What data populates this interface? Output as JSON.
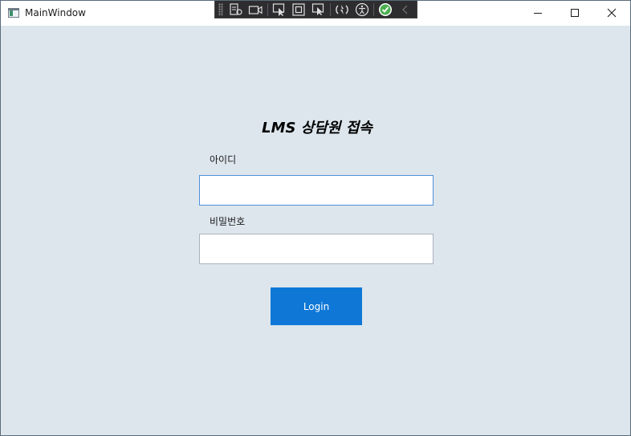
{
  "window": {
    "title": "MainWindow",
    "controls": {
      "minimize_icon": "minimize-icon",
      "maximize_icon": "maximize-icon",
      "close_icon": "close-icon"
    }
  },
  "debug_toolbar": {
    "icons": [
      "live-visual-tree-icon",
      "record-icon",
      "select-element-icon",
      "display-layout-adorners-icon",
      "track-focused-element-icon",
      "hot-reload-icon",
      "accessibility-icon",
      "check-icon",
      "collapse-chevron-icon"
    ]
  },
  "form": {
    "heading": "LMS 상담원 접속",
    "id_label": "아이디",
    "id_value": "",
    "password_label": "비밀번호",
    "password_value": "",
    "login_button": "Login"
  },
  "colors": {
    "client_background": "#dde6ed",
    "button_accent": "#0f78d7",
    "focused_border": "#4f8fd8",
    "debug_toolbar_bg": "#2d2d30"
  }
}
